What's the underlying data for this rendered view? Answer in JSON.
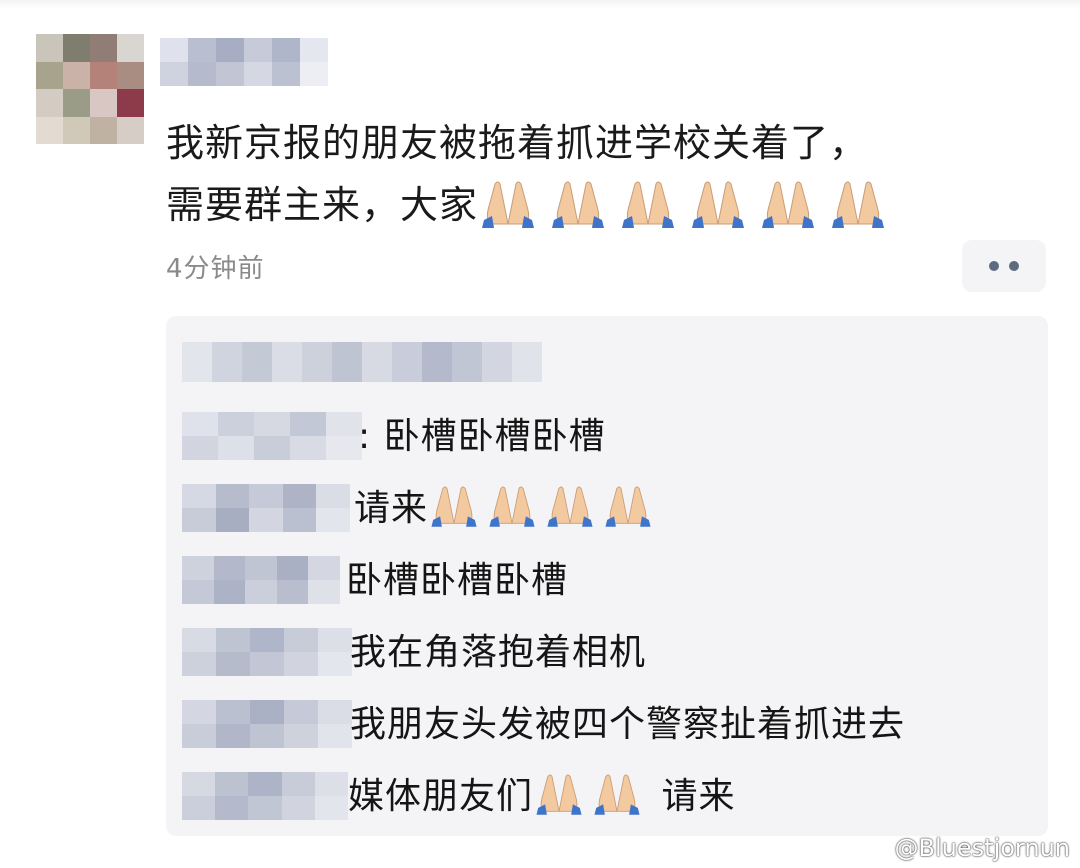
{
  "post": {
    "line1": "我新京报的朋友被拖着抓进学校关着了，",
    "line2": "需要群主来，大家",
    "time": "4分钟前"
  },
  "comments": [
    {
      "text": ": 卧槽卧槽卧槽"
    },
    {
      "text": "请来"
    },
    {
      "text": "卧槽卧槽卧槽"
    },
    {
      "text": "我在角落抱着相机"
    },
    {
      "text": "我朋友头发被四个警察扯着抓进去"
    },
    {
      "text": "媒体朋友们"
    },
    {
      "text": "请来"
    }
  ],
  "watermark": "@Bluestjornun",
  "icons": {
    "emoji": "folded-hands-emoji",
    "more": "more-dots-icon",
    "weibo": "weibo-icon"
  }
}
